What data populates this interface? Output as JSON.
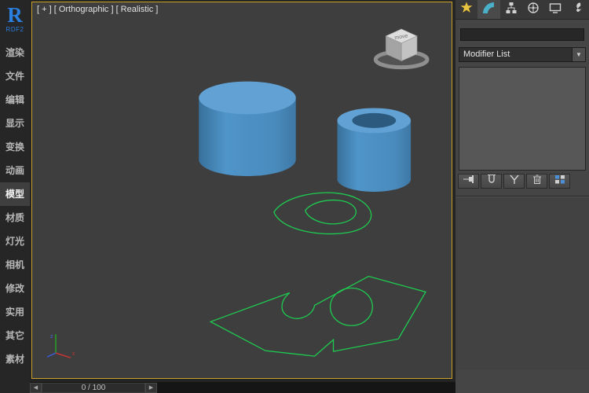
{
  "logo": {
    "letter": "R",
    "subtitle": "RDF2"
  },
  "sidebar": {
    "items": [
      {
        "label": "渲染",
        "selected": false
      },
      {
        "label": "文件",
        "selected": false
      },
      {
        "label": "编辑",
        "selected": false
      },
      {
        "label": "显示",
        "selected": false
      },
      {
        "label": "变换",
        "selected": false
      },
      {
        "label": "动画",
        "selected": false
      },
      {
        "label": "模型",
        "selected": true
      },
      {
        "label": "材质",
        "selected": false
      },
      {
        "label": "灯光",
        "selected": false
      },
      {
        "label": "相机",
        "selected": false
      },
      {
        "label": "修改",
        "selected": false
      },
      {
        "label": "实用",
        "selected": false
      },
      {
        "label": "其它",
        "selected": false
      },
      {
        "label": "素材",
        "selected": false
      }
    ]
  },
  "viewport": {
    "label": "[ + ] [ Orthographic ] [ Realistic ]",
    "viewcube_label": "move",
    "objects": [
      "blue-cylinder",
      "blue-tube",
      "green-teardrop-spline",
      "green-plate-spline"
    ]
  },
  "command_panel": {
    "tabs": [
      {
        "icon": "create-icon"
      },
      {
        "icon": "modify-icon"
      },
      {
        "icon": "hierarchy-icon"
      },
      {
        "icon": "motion-icon"
      },
      {
        "icon": "display-icon"
      },
      {
        "icon": "utilities-icon"
      }
    ],
    "name_field": {
      "value": "",
      "placeholder": ""
    },
    "modifier_list": {
      "label": "Modifier List",
      "arrow": "▼"
    },
    "stack_buttons": [
      {
        "icon": "pin-stack-icon"
      },
      {
        "icon": "show-end-result-icon"
      },
      {
        "icon": "make-unique-icon"
      },
      {
        "icon": "remove-modifier-icon"
      },
      {
        "icon": "configure-modifier-sets-icon"
      }
    ]
  },
  "timeline": {
    "prev": "◀",
    "next": "▶",
    "frame": "0 / 100"
  },
  "colors": {
    "viewport_border": "#c9a227",
    "object_blue": "#61a1d3",
    "spline_green": "#1ecb50",
    "logo_blue": "#2a7fdf"
  }
}
